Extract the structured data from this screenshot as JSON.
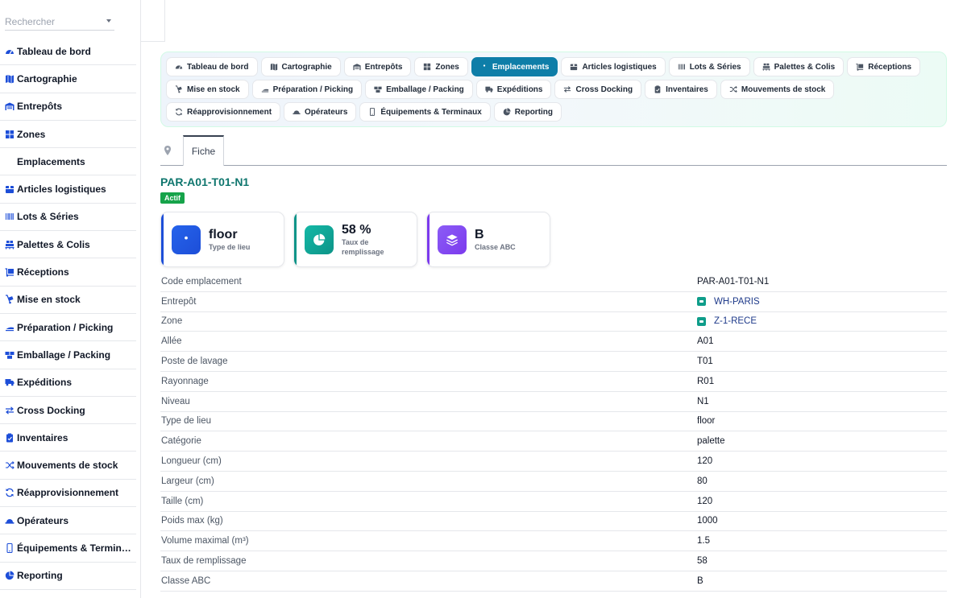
{
  "search": {
    "placeholder": "Rechercher"
  },
  "sidebar": {
    "items": [
      {
        "label": "Tableau de bord",
        "icon": "dashboard-icon"
      },
      {
        "label": "Cartographie",
        "icon": "map-icon"
      },
      {
        "label": "Entrepôts",
        "icon": "warehouse-icon"
      },
      {
        "label": "Zones",
        "icon": "grid-icon"
      },
      {
        "label": "Emplacements",
        "icon": "location-pin-icon"
      },
      {
        "label": "Articles logistiques",
        "icon": "box-icon"
      },
      {
        "label": "Lots & Séries",
        "icon": "barcode-icon"
      },
      {
        "label": "Palettes & Colis",
        "icon": "pallet-icon"
      },
      {
        "label": "Réceptions",
        "icon": "dolly-icon"
      },
      {
        "label": "Mise en stock",
        "icon": "hand-truck-icon"
      },
      {
        "label": "Préparation / Picking",
        "icon": "picking-icon"
      },
      {
        "label": "Emballage / Packing",
        "icon": "boxes-icon"
      },
      {
        "label": "Expéditions",
        "icon": "truck-icon"
      },
      {
        "label": "Cross Docking",
        "icon": "arrows-left-right-icon"
      },
      {
        "label": "Inventaires",
        "icon": "clipboard-check-icon"
      },
      {
        "label": "Mouvements de stock",
        "icon": "shuffle-icon"
      },
      {
        "label": "Réapprovisionnement",
        "icon": "refresh-icon"
      },
      {
        "label": "Opérateurs",
        "icon": "hard-hat-icon"
      },
      {
        "label": "Équipements & Terminaux",
        "icon": "mobile-icon"
      },
      {
        "label": "Reporting",
        "icon": "pie-chart-icon"
      }
    ]
  },
  "tabs": [
    {
      "label": "Tableau de bord",
      "icon": "dashboard-icon",
      "active": false
    },
    {
      "label": "Cartographie",
      "icon": "map-icon",
      "active": false
    },
    {
      "label": "Entrepôts",
      "icon": "warehouse-icon",
      "active": false
    },
    {
      "label": "Zones",
      "icon": "grid-icon",
      "active": false
    },
    {
      "label": "Emplacements",
      "icon": "location-pin-icon",
      "active": true
    },
    {
      "label": "Articles logistiques",
      "icon": "box-icon",
      "active": false
    },
    {
      "label": "Lots & Séries",
      "icon": "barcode-icon",
      "active": false
    },
    {
      "label": "Palettes & Colis",
      "icon": "pallet-icon",
      "active": false
    },
    {
      "label": "Réceptions",
      "icon": "dolly-icon",
      "active": false
    },
    {
      "label": "Mise en stock",
      "icon": "hand-truck-icon",
      "active": false
    },
    {
      "label": "Préparation / Picking",
      "icon": "picking-icon",
      "active": false
    },
    {
      "label": "Emballage / Packing",
      "icon": "boxes-icon",
      "active": false
    },
    {
      "label": "Expéditions",
      "icon": "truck-icon",
      "active": false
    },
    {
      "label": "Cross Docking",
      "icon": "arrows-left-right-icon",
      "active": false
    },
    {
      "label": "Inventaires",
      "icon": "clipboard-check-icon",
      "active": false
    },
    {
      "label": "Mouvements de stock",
      "icon": "shuffle-icon",
      "active": false
    },
    {
      "label": "Réapprovisionnement",
      "icon": "refresh-icon",
      "active": false
    },
    {
      "label": "Opérateurs",
      "icon": "hard-hat-icon",
      "active": false
    },
    {
      "label": "Équipements & Terminaux",
      "icon": "mobile-icon",
      "active": false
    },
    {
      "label": "Reporting",
      "icon": "pie-chart-icon",
      "active": false
    }
  ],
  "subtab": {
    "label": "Fiche"
  },
  "record": {
    "title": "PAR-A01-T01-N1",
    "status": "Actif"
  },
  "kpis": [
    {
      "value": "floor",
      "label": "Type de lieu",
      "icon": "location-pin-icon",
      "color": "#1d4ed8",
      "accent": "#2563eb"
    },
    {
      "value": "58 %",
      "label": "Taux de remplissage",
      "icon": "pie-chart-icon",
      "color": "#0d9488",
      "accent": "#14b8a6"
    },
    {
      "value": "B",
      "label": "Classe ABC",
      "icon": "layers-icon",
      "color": "#7c3aed",
      "accent": "#8b5cf6"
    }
  ],
  "details": [
    {
      "key": "Code emplacement",
      "value": "PAR-A01-T01-N1"
    },
    {
      "key": "Entrepôt",
      "value": "WH-PARIS",
      "link": true
    },
    {
      "key": "Zone",
      "value": "Z-1-RECE",
      "link": true
    },
    {
      "key": "Allée",
      "value": "A01"
    },
    {
      "key": "Poste de lavage",
      "value": "T01"
    },
    {
      "key": "Rayonnage",
      "value": "R01"
    },
    {
      "key": "Niveau",
      "value": "N1"
    },
    {
      "key": "Type de lieu",
      "value": "floor"
    },
    {
      "key": "Catégorie",
      "value": "palette"
    },
    {
      "key": "Longueur (cm)",
      "value": "120"
    },
    {
      "key": "Largeur (cm)",
      "value": "80"
    },
    {
      "key": "Taille (cm)",
      "value": "120"
    },
    {
      "key": "Poids max (kg)",
      "value": "1000"
    },
    {
      "key": "Volume maximal (m³)",
      "value": "1.5"
    },
    {
      "key": "Taux de remplissage",
      "value": "58"
    },
    {
      "key": "Classe ABC",
      "value": "B"
    }
  ]
}
